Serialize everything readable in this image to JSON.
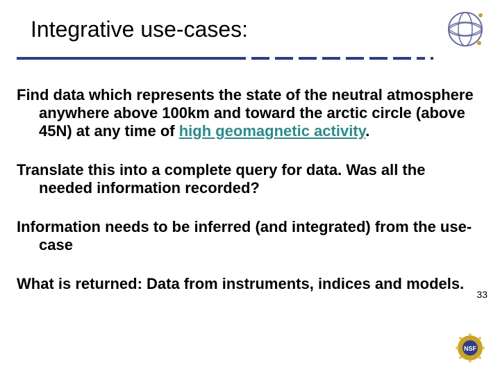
{
  "title": "Integrative use-cases:",
  "paragraphs": {
    "p1_prefix": "Find data which represents the state of the neutral atmosphere anywhere above 100km and toward the arctic circle (above 45N) at any time of ",
    "p1_link": "high geomagnetic activity",
    "p1_suffix": ".",
    "p2": "Translate this into a complete query for data. Was all the needed information recorded?",
    "p3": "Information needs to be inferred (and integrated) from the use-case",
    "p4": "What is returned: Data from instruments, indices and models."
  },
  "page_number": "33",
  "icons": {
    "top_right": "decorative-globe-icon",
    "bottom_right": "nsf-badge-icon"
  }
}
